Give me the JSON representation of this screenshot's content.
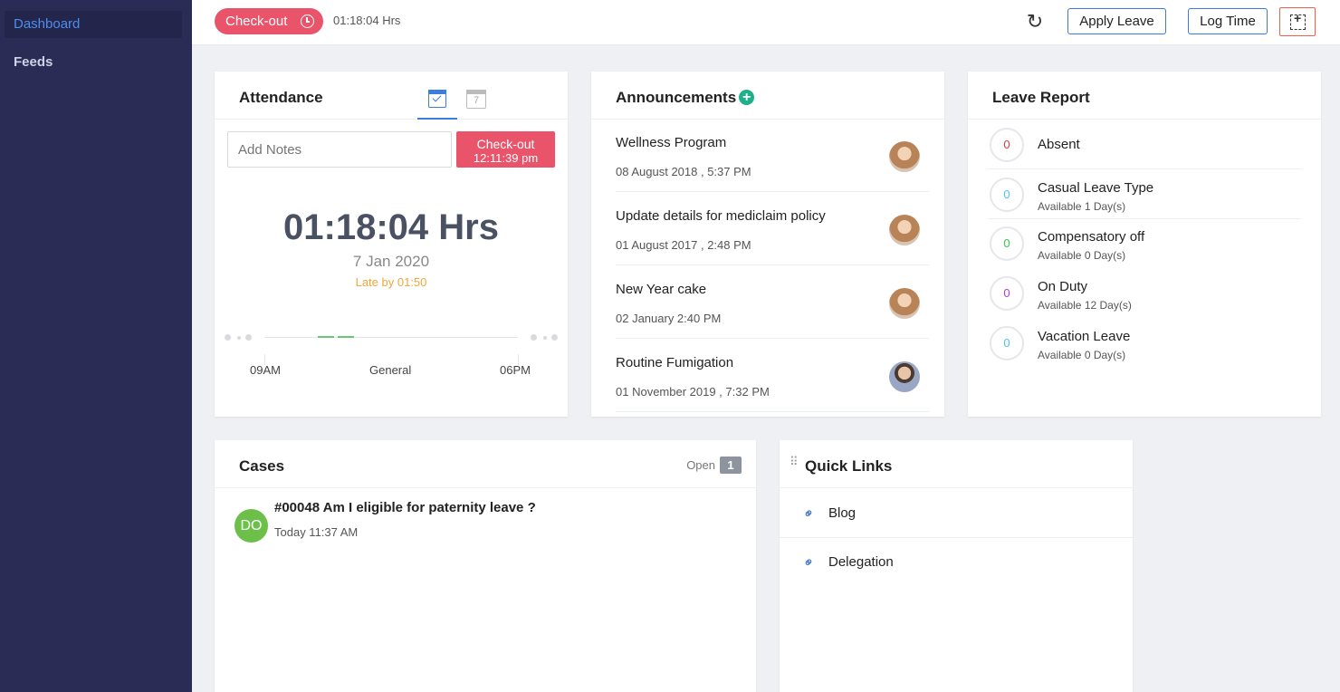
{
  "sidebar": {
    "items": [
      {
        "label": "Dashboard"
      },
      {
        "label": "Feeds"
      }
    ]
  },
  "topbar": {
    "checkout_label": "Check-out",
    "elapsed": "01:18:04 Hrs",
    "apply_leave": "Apply Leave",
    "log_time": "Log Time"
  },
  "attendance": {
    "title": "Attendance",
    "calendar_day": "7",
    "notes_placeholder": "Add Notes",
    "checkout_label": "Check-out",
    "checkout_time": "12:11:39 pm",
    "hours": "01:18:04 Hrs",
    "date": "7 Jan 2020",
    "late": "Late by 01:50",
    "timeline_start": "09AM",
    "timeline_shift": "General",
    "timeline_end": "06PM"
  },
  "announcements": {
    "title": "Announcements",
    "items": [
      {
        "title": "Wellness Program",
        "date": "08 August 2018 , 5:37 PM"
      },
      {
        "title": "Update details for mediclaim policy",
        "date": "01 August 2017 , 2:48 PM"
      },
      {
        "title": "New Year cake",
        "date": "02 January 2:40 PM"
      },
      {
        "title": "Routine Fumigation",
        "date": "01 November 2019 , 7:32 PM"
      }
    ]
  },
  "leave_report": {
    "title": "Leave Report",
    "items": [
      {
        "count": "0",
        "name": "Absent",
        "sub": "",
        "color": "#e53935"
      },
      {
        "count": "0",
        "name": "Casual Leave Type",
        "sub": "Available 1 Day(s)",
        "color": "#4fc3f7"
      },
      {
        "count": "0",
        "name": "Compensatory off",
        "sub": "Available 0 Day(s)",
        "color": "#2ecc40"
      },
      {
        "count": "0",
        "name": "On Duty",
        "sub": "Available 12 Day(s)",
        "color": "#b03ae0"
      },
      {
        "count": "0",
        "name": "Vacation Leave",
        "sub": "Available 0 Day(s)",
        "color": "#4fc3f7"
      }
    ]
  },
  "cases": {
    "title": "Cases",
    "open_label": "Open",
    "open_count": "1",
    "items": [
      {
        "initials": "DO",
        "title": "#00048  Am I eligible for paternity leave ?",
        "date": "Today 11:37 AM"
      }
    ]
  },
  "quick_links": {
    "title": "Quick Links",
    "items": [
      {
        "label": "Blog"
      },
      {
        "label": "Delegation"
      }
    ]
  },
  "colors": {
    "sidebar": "#2a2c56",
    "accent": "#3d7de2",
    "checkout": "#e9546b",
    "late": "#f0a63a"
  }
}
